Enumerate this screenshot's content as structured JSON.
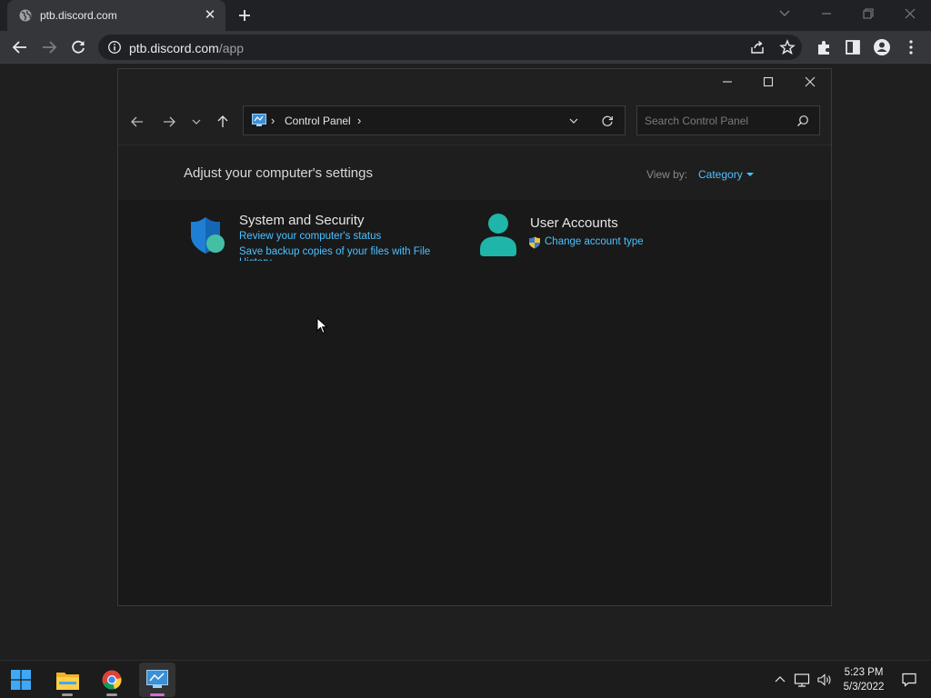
{
  "browser": {
    "tab": {
      "title": "ptb.discord.com"
    },
    "url": {
      "host": "ptb.discord.com",
      "path": "/app"
    }
  },
  "control_panel": {
    "breadcrumb": "Control Panel",
    "search_placeholder": "Search Control Panel",
    "heading": "Adjust your computer's settings",
    "view_by_label": "View by:",
    "view_by_value": "Category",
    "categories": [
      {
        "title": "System and Security",
        "icon": "shield-icon",
        "links": [
          "Review your computer's status",
          "Save backup copies of your files with File History"
        ]
      },
      {
        "title": "User Accounts",
        "icon": "user-icon",
        "links": [
          "Change account type"
        ]
      }
    ]
  },
  "taskbar": {
    "apps": [
      "start-icon",
      "file-explorer-icon",
      "chrome-icon",
      "control-panel-icon"
    ],
    "clock": {
      "time": "5:23 PM",
      "date": "5/3/2022"
    }
  },
  "colors": {
    "link": "#4cc2ff",
    "accent": "#d86cd8"
  }
}
